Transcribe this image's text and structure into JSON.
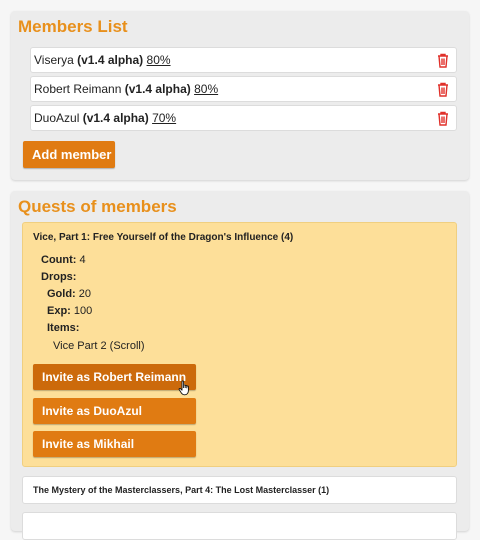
{
  "members_panel": {
    "title": "Members List",
    "members": [
      {
        "name": "Viserya",
        "version": "(v1.4 alpha)",
        "percent": "80%"
      },
      {
        "name": "Robert Reimann",
        "version": "(v1.4 alpha)",
        "percent": "80%"
      },
      {
        "name": "DuoAzul",
        "version": "(v1.4 alpha)",
        "percent": "70%"
      }
    ],
    "add_member_label": "Add member"
  },
  "quests_panel": {
    "title": "Quests of members",
    "open_quest": {
      "title": "Vice, Part 1: Free Yourself of the Dragon's Influence (4)",
      "count_label": "Count:",
      "count_value": "4",
      "drops_label": "Drops:",
      "gold_label": "Gold:",
      "gold_value": "20",
      "exp_label": "Exp:",
      "exp_value": "100",
      "items_label": "Items:",
      "items": [
        "Vice Part 2 (Scroll)"
      ],
      "invite_buttons": [
        "Invite as Robert Reimann",
        "Invite as DuoAzul",
        "Invite as Mikhail"
      ]
    },
    "other_quests": [
      "The Mystery of the Masterclassers, Part 4: The Lost Masterclasser (1)",
      ""
    ]
  },
  "colors": {
    "accent": "#e8901c",
    "button": "#e07b12",
    "quest_bg": "#fddf99",
    "delete": "#e0302a"
  },
  "icons": {
    "delete": "trash-icon",
    "cursor": "hand-pointer-icon"
  }
}
